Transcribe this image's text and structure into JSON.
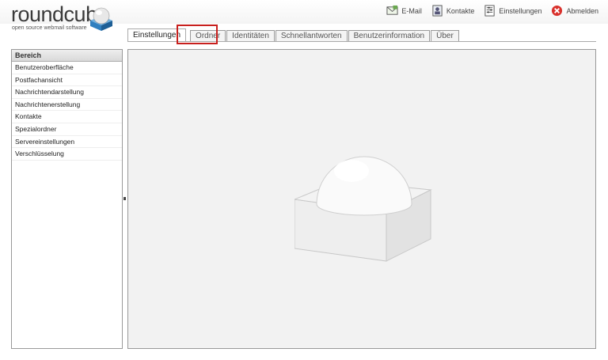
{
  "logo": {
    "wordmark": "roundcube",
    "tagline": "open source webmail software"
  },
  "topnav": [
    {
      "label": "E-Mail",
      "icon": "mail-icon"
    },
    {
      "label": "Kontakte",
      "icon": "addressbook-icon"
    },
    {
      "label": "Einstellungen",
      "icon": "settings-icon"
    },
    {
      "label": "Abmelden",
      "icon": "logout-icon"
    }
  ],
  "tabs": [
    {
      "label": "Einstellungen",
      "active": true
    },
    {
      "label": "Ordner"
    },
    {
      "label": "Identitäten"
    },
    {
      "label": "Schnellantworten"
    },
    {
      "label": "Benutzerinformation"
    },
    {
      "label": "Über"
    }
  ],
  "sections": {
    "header": "Bereich",
    "items": [
      "Benutzeroberfläche",
      "Postfachansicht",
      "Nachrichtendarstellung",
      "Nachrichtenerstellung",
      "Kontakte",
      "Spezialordner",
      "Servereinstellungen",
      "Verschlüsselung"
    ]
  },
  "colors": {
    "highlight": "#c8201e",
    "logout": "#d9312c",
    "cube_blue": "#2f7fbf"
  }
}
